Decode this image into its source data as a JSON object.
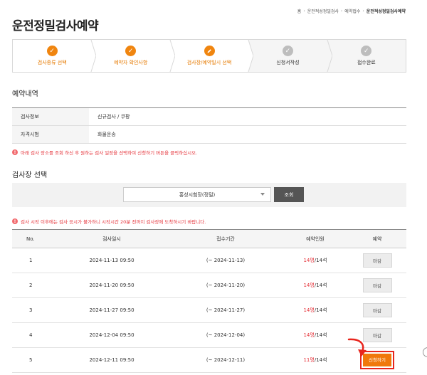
{
  "breadcrumb": [
    "홈",
    "운전적성정밀검사",
    "예약접수",
    "운전적성정밀검사예약"
  ],
  "page_title": "운전정밀검사예약",
  "steps": [
    {
      "label": "검사종류 선택",
      "status": "done",
      "icon": "check-icon"
    },
    {
      "label": "예약자 확인사항",
      "status": "done",
      "icon": "check-icon"
    },
    {
      "label": "검사장/예약일시 선택",
      "status": "current",
      "icon": "pencil-icon"
    },
    {
      "label": "신청서작성",
      "status": "todo",
      "icon": "check-icon"
    },
    {
      "label": "접수완료",
      "status": "todo",
      "icon": "check-icon"
    }
  ],
  "reservation": {
    "title": "예약내역",
    "rows": [
      {
        "key": "검사정보",
        "value": "신규검사 / 쿠팡"
      },
      {
        "key": "자격시험",
        "value": "화물운송"
      }
    ],
    "notice": "아래 검사 장소를 조회 하신 후 원하는 검사 일정을 선택하여 신청하기 버튼을 클릭하십시오."
  },
  "site_select": {
    "title": "검사장 선택",
    "selected": "홍성시험장(정밀)",
    "search_label": "조회",
    "notice": "검사 시작 이후에는 검사 응시가 불가하니 시작시간 20분 전까지 검사장에 도착하시기 바랍니다."
  },
  "schedule": {
    "headers": [
      "No.",
      "검사일시",
      "접수기간",
      "예약인원",
      "예약"
    ],
    "rows": [
      {
        "no": "1",
        "datetime": "2024-11-13 09:50",
        "period": "(~ 2024-11-13)",
        "booked": "14명",
        "capacity": "/14석",
        "action": "마감",
        "type": "closed"
      },
      {
        "no": "2",
        "datetime": "2024-11-20 09:50",
        "period": "(~ 2024-11-20)",
        "booked": "14명",
        "capacity": "/14석",
        "action": "마감",
        "type": "closed"
      },
      {
        "no": "3",
        "datetime": "2024-11-27 09:50",
        "period": "(~ 2024-11-27)",
        "booked": "14명",
        "capacity": "/14석",
        "action": "마감",
        "type": "closed"
      },
      {
        "no": "4",
        "datetime": "2024-12-04 09:50",
        "period": "(~ 2024-12-04)",
        "booked": "14명",
        "capacity": "/14석",
        "action": "마감",
        "type": "closed"
      },
      {
        "no": "5",
        "datetime": "2024-12-11 09:50",
        "period": "(~ 2024-12-11)",
        "booked": "11명",
        "capacity": "/14석",
        "action": "신청하기",
        "type": "apply"
      }
    ]
  },
  "colors": {
    "accent": "#f0850f",
    "alert": "#e5333a",
    "highlight": "#e8261e"
  }
}
